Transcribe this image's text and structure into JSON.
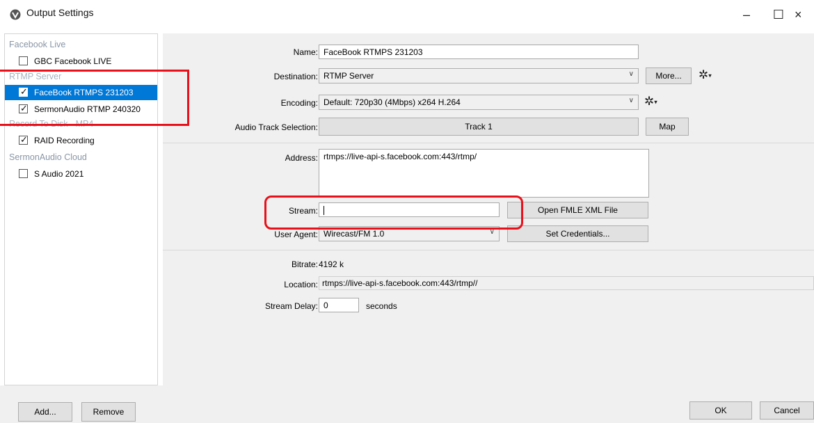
{
  "window": {
    "title": "Output Settings",
    "minimize": "–",
    "maximize": "☐",
    "close": "×"
  },
  "sidebar": {
    "groups": [
      {
        "header": "Facebook Live",
        "items": [
          {
            "label": "GBC Facebook LIVE",
            "checked": false,
            "selected": false
          }
        ]
      },
      {
        "header": "RTMP Server",
        "items": [
          {
            "label": "FaceBook RTMPS 231203",
            "checked": true,
            "selected": true
          },
          {
            "label": "SermonAudio RTMP 240320",
            "checked": true,
            "selected": false
          }
        ]
      },
      {
        "header": "Record To Disk - MP4",
        "items": [
          {
            "label": "RAID Recording",
            "checked": true,
            "selected": false
          }
        ]
      },
      {
        "header": "SermonAudio Cloud",
        "items": [
          {
            "label": "S Audio 2021",
            "checked": false,
            "selected": false
          }
        ]
      }
    ],
    "add_label": "Add...",
    "remove_label": "Remove"
  },
  "form": {
    "name_label": "Name:",
    "name_value": "FaceBook RTMPS 231203",
    "destination_label": "Destination:",
    "destination_value": "RTMP Server",
    "more_label": "More...",
    "encoding_label": "Encoding:",
    "encoding_value": "Default: 720p30 (4Mbps) x264 H.264",
    "audio_track_label": "Audio Track Selection:",
    "audio_track_value": "Track 1",
    "map_label": "Map",
    "address_label": "Address:",
    "address_value": "rtmps://live-api-s.facebook.com:443/rtmp/",
    "stream_label": "Stream:",
    "stream_value": "",
    "open_fmle_label": "Open FMLE XML File",
    "user_agent_label": "User Agent:",
    "user_agent_value": "Wirecast/FM 1.0",
    "set_credentials_label": "Set Credentials...",
    "bitrate_label": "Bitrate:",
    "bitrate_value": "4192 k",
    "location_label": "Location:",
    "location_value": "rtmps://live-api-s.facebook.com:443/rtmp//",
    "stream_delay_label": "Stream Delay:",
    "stream_delay_value": "0",
    "stream_delay_unit": "seconds"
  },
  "footer": {
    "ok_label": "OK",
    "cancel_label": "Cancel"
  },
  "icons": {
    "gear_glyph": "✲",
    "dropdown_glyph": "∨",
    "check_glyph": "✓"
  },
  "colors": {
    "selection": "#0078d7",
    "highlight": "#e8111b",
    "panel": "#f0f0f0"
  }
}
